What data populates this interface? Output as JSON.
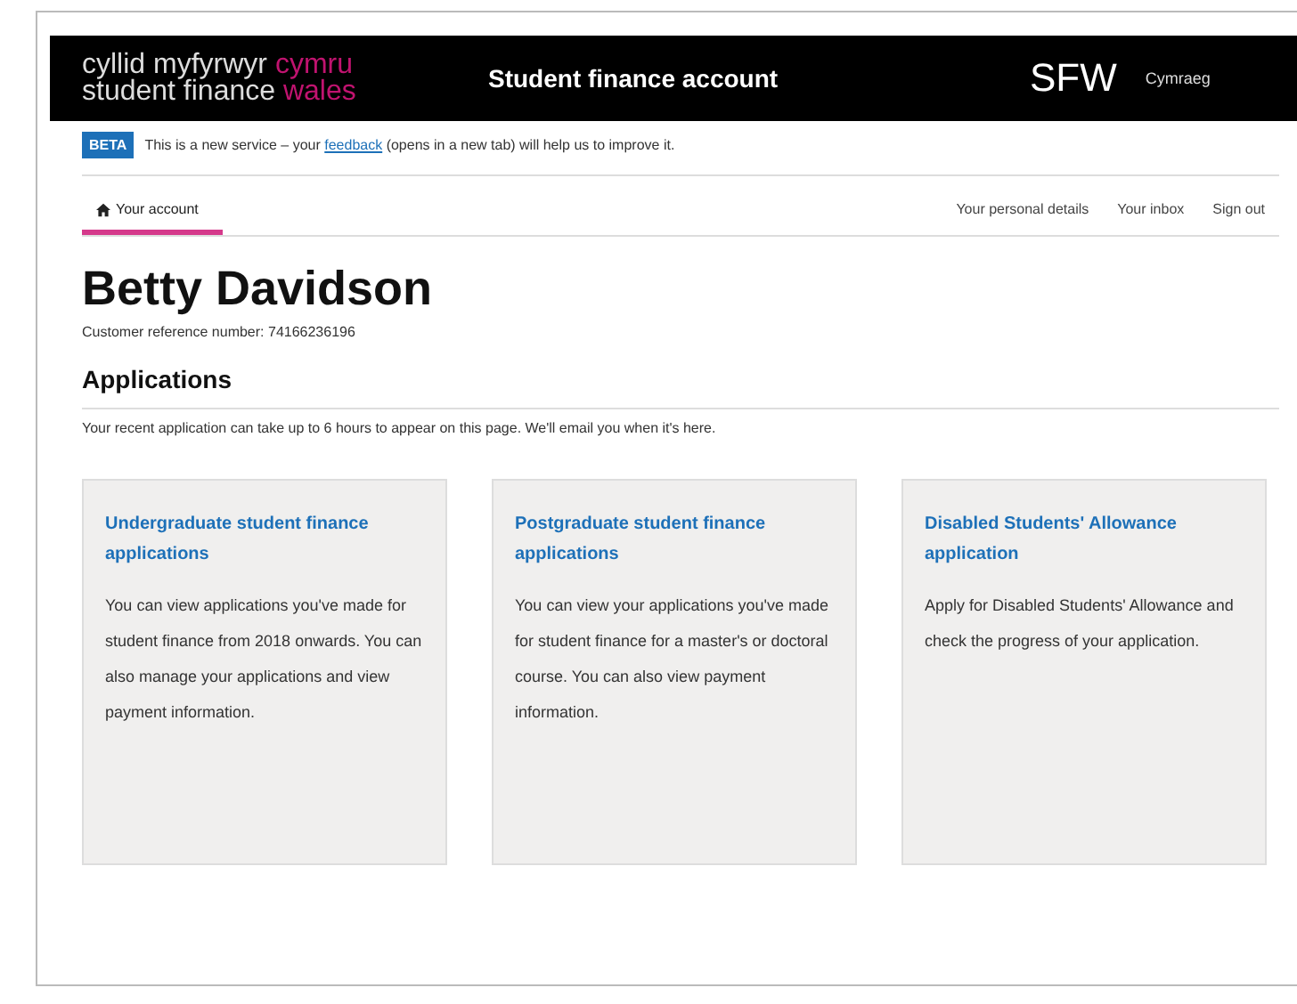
{
  "header": {
    "logo": [
      {
        "text": "cyllid myfyrwyr",
        "accent": "cymru"
      },
      {
        "text": "student finance",
        "accent": "wales"
      }
    ],
    "title": "Student finance account",
    "short_logo": "SFW",
    "language_link": "Cymraeg"
  },
  "beta_banner": {
    "tag": "BETA",
    "before": "This is a new service – your ",
    "link": "feedback",
    "after": " (opens in a new tab) will help us to improve it."
  },
  "nav": [
    {
      "label": "Your account",
      "selected": true,
      "kind": "home"
    },
    {
      "label": "Your personal details",
      "selected": false,
      "kind": "plain"
    },
    {
      "label": "Your inbox",
      "selected": false,
      "kind": "plain"
    },
    {
      "label": "Sign out",
      "selected": false,
      "kind": "plain"
    }
  ],
  "name": "Betty Davidson",
  "reference": "Customer reference number: 74166236196",
  "section_heading": "Applications",
  "notice": "Your recent application can take up to 6 hours to appear on this page. We'll email you when it's here.",
  "cards": [
    {
      "title": "Undergraduate student finance applications",
      "body": "You can view applications you've made for student finance from 2018 onwards. You can also manage your applications and view payment information."
    },
    {
      "title": "Postgraduate student finance applications",
      "body": "You can view your applications you've made for student finance for a master's or doctoral course. You can also view payment information."
    },
    {
      "title": "Disabled Students' Allowance application",
      "body": "Apply for Disabled Students' Allowance and check the progress of your application."
    }
  ]
}
